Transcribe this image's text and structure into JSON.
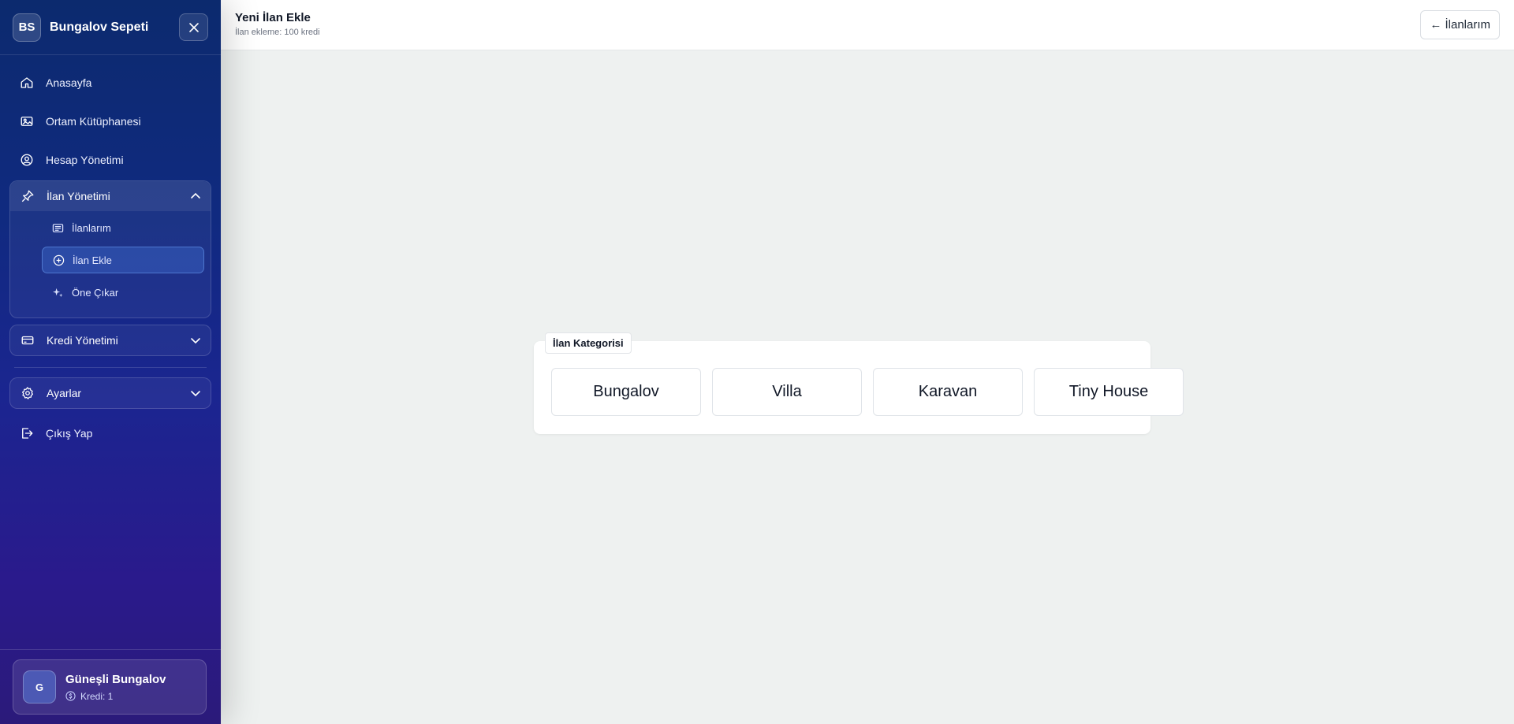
{
  "brand": {
    "badge": "BS",
    "name": "Bungalov Sepeti"
  },
  "sidebar": {
    "items": [
      {
        "label": "Anasayfa",
        "icon": "home-icon"
      },
      {
        "label": "Ortam Kütüphanesi",
        "icon": "image-icon"
      },
      {
        "label": "Hesap Yönetimi",
        "icon": "user-circle-icon"
      }
    ],
    "ilan_group": {
      "label": "İlan Yönetimi",
      "icon": "pin-icon",
      "sub_items": [
        {
          "label": "İlanlarım",
          "icon": "list-icon"
        },
        {
          "label": "İlan Ekle",
          "icon": "plus-circle-icon",
          "active": true
        },
        {
          "label": "Öne Çıkar",
          "icon": "sparkle-icon"
        }
      ]
    },
    "kredi_group": {
      "label": "Kredi Yönetimi",
      "icon": "credit-card-icon"
    },
    "ayarlar_group": {
      "label": "Ayarlar",
      "icon": "gear-icon"
    },
    "logout": {
      "label": "Çıkış Yap",
      "icon": "logout-icon"
    }
  },
  "profile": {
    "initial": "G",
    "name": "Güneşli Bungalov",
    "credit": "Kredi: 1"
  },
  "header": {
    "title": "Yeni İlan Ekle",
    "subtitle": "İlan ekleme: 100 kredi",
    "back_label": "← İlanlarım"
  },
  "category": {
    "legend": "İlan Kategorisi",
    "options": [
      "Bungalov",
      "Villa",
      "Karavan",
      "Tiny House"
    ]
  }
}
